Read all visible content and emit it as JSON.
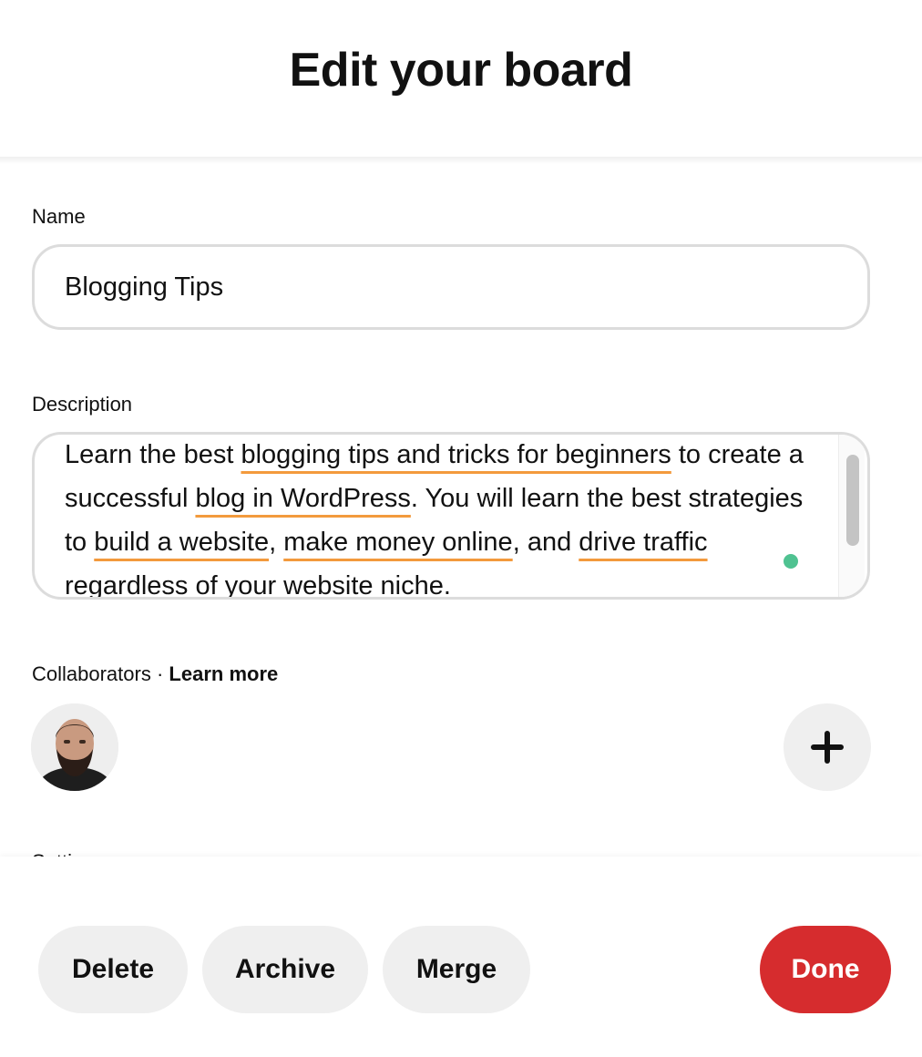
{
  "header": {
    "title": "Edit your board"
  },
  "name_field": {
    "label": "Name",
    "value": "Blogging Tips"
  },
  "description_field": {
    "label": "Description",
    "segments": [
      "Learn the best ",
      "blogging tips and tricks for beginners",
      " to create a successful ",
      "blog in WordPress",
      ". You will learn the best strategies to ",
      "build a website",
      ", ",
      "make money online",
      ", and ",
      "drive traffic",
      " regardless of your website niche."
    ],
    "highlight_color": "#f39a3d"
  },
  "collaborators": {
    "label": "Collaborators",
    "separator": "·",
    "learn_more": "Learn more",
    "add_icon": "plus-icon"
  },
  "settings": {
    "label": "Settings"
  },
  "footer": {
    "delete_label": "Delete",
    "archive_label": "Archive",
    "merge_label": "Merge",
    "done_label": "Done"
  },
  "colors": {
    "accent": "#d62c2e",
    "button_bg": "#efefef",
    "border": "#dcdcdc",
    "cursor_dot": "#4fc291"
  }
}
